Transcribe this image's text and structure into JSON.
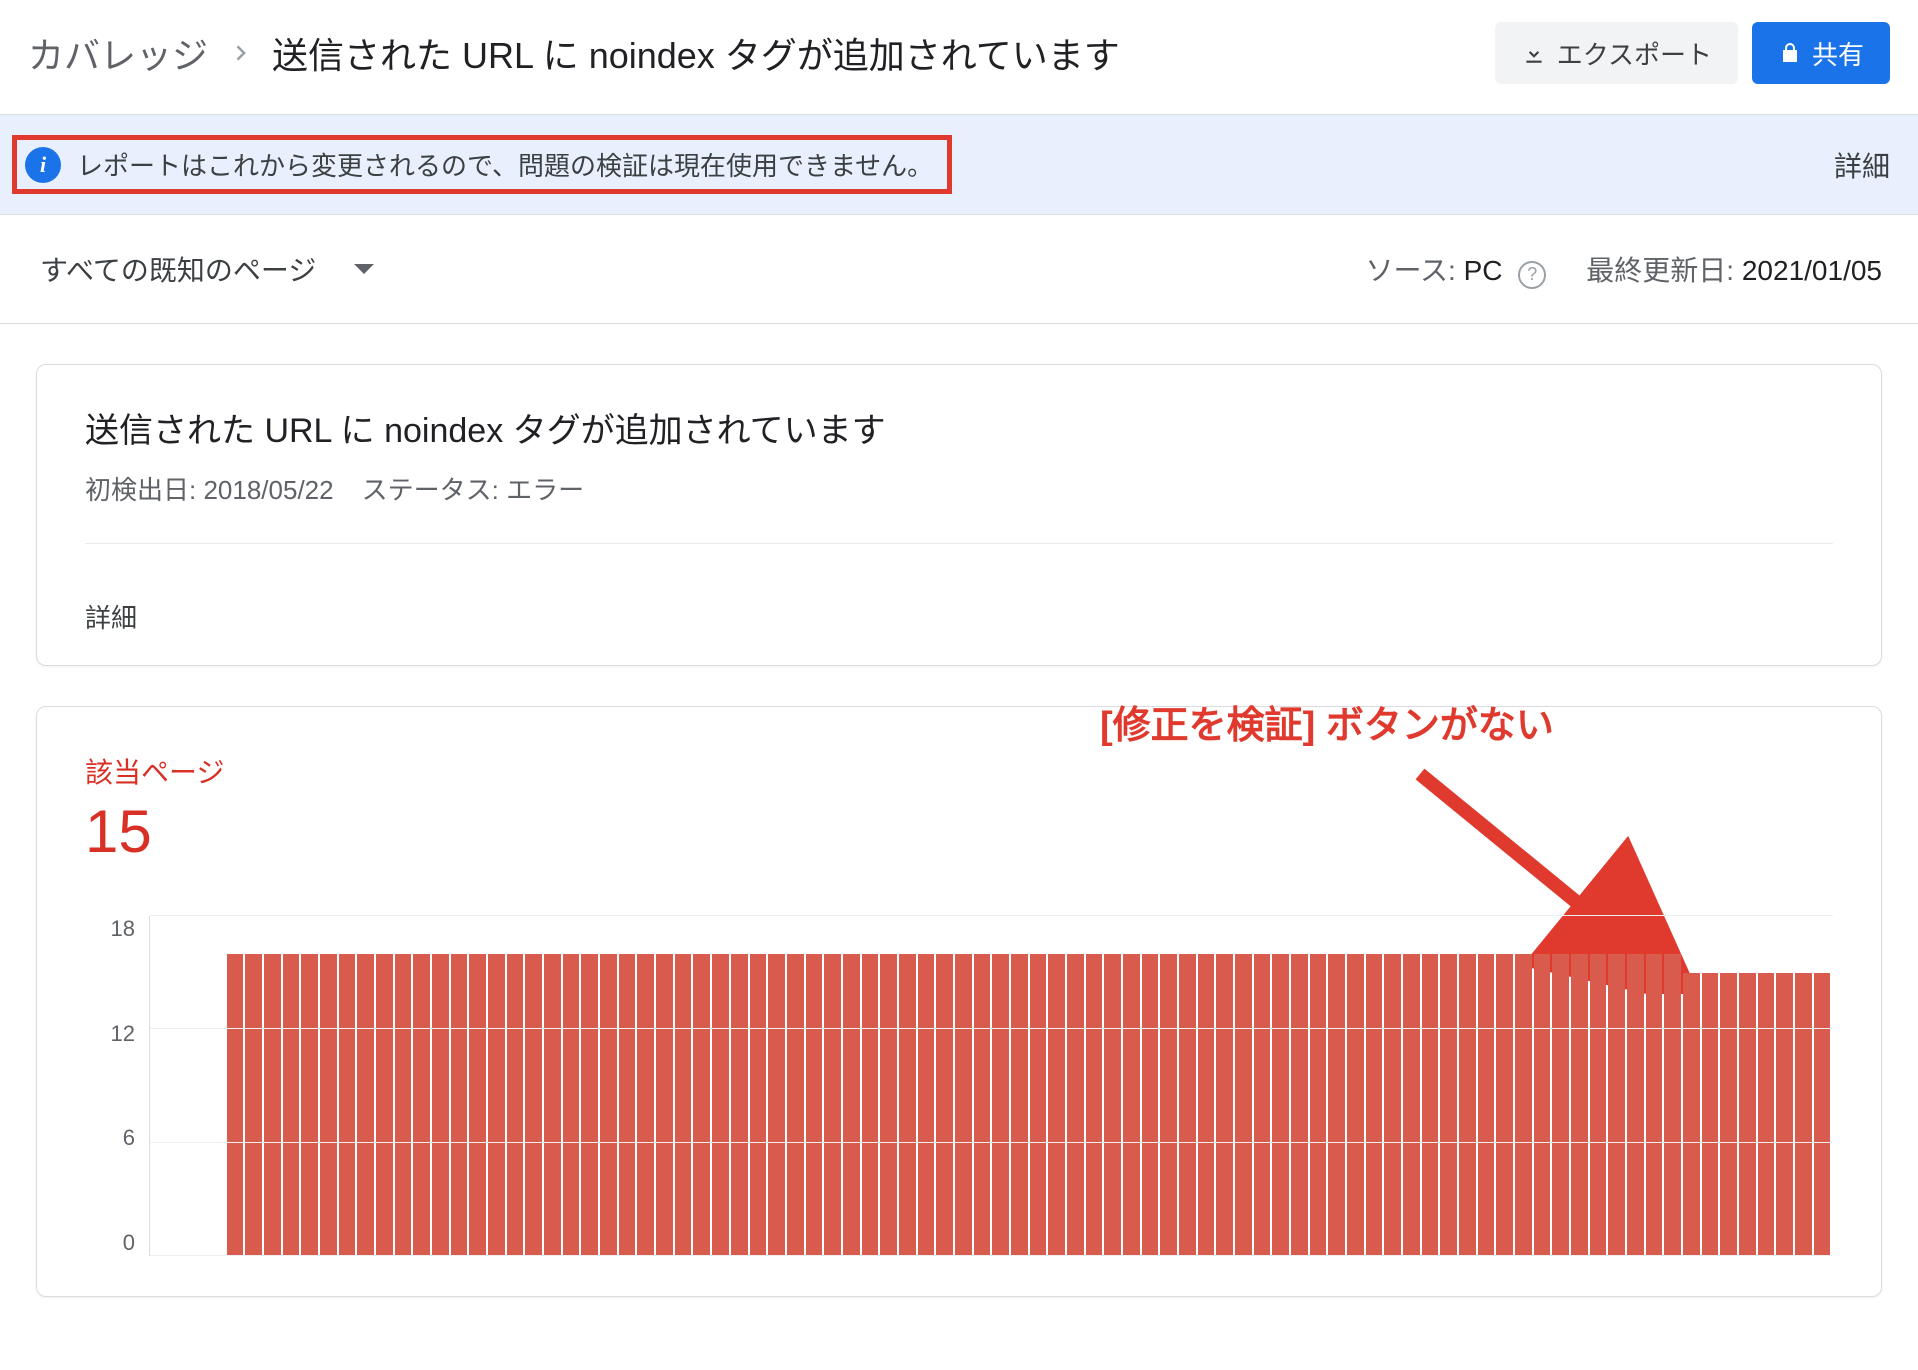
{
  "header": {
    "breadcrumb_root": "カバレッジ",
    "breadcrumb_current": "送信された URL に noindex タグが追加されています",
    "export_label": "エクスポート",
    "share_label": "共有"
  },
  "banner": {
    "text": "レポートはこれから変更されるので、問題の検証は現在使用できません。",
    "details_label": "詳細"
  },
  "filter": {
    "dropdown_label": "すべての既知のページ",
    "source_label": "ソース:",
    "source_value": "PC",
    "updated_label": "最終更新日:",
    "updated_value": "2021/01/05"
  },
  "card": {
    "title": "送信された URL に noindex タグが追加されています",
    "first_detected_label": "初検出日:",
    "first_detected_value": "2018/05/22",
    "status_label": "ステータス:",
    "status_value": "エラー",
    "details_label": "詳細"
  },
  "annotation": {
    "text": "[修正を検証] ボタンがない"
  },
  "chart": {
    "label": "該当ページ",
    "value": "15"
  },
  "chart_data": {
    "type": "bar",
    "title": "該当ページ",
    "ylabel": "",
    "xlabel": "",
    "ylim": [
      0,
      18
    ],
    "y_ticks": [
      18,
      12,
      6,
      0
    ],
    "categories_count": 90,
    "series": [
      {
        "name": "該当ページ",
        "color": "#d95b4e",
        "values": [
          0,
          0,
          0,
          0,
          16,
          16,
          16,
          16,
          16,
          16,
          16,
          16,
          16,
          16,
          16,
          16,
          16,
          16,
          16,
          16,
          16,
          16,
          16,
          16,
          16,
          16,
          16,
          16,
          16,
          16,
          16,
          16,
          16,
          16,
          16,
          16,
          16,
          16,
          16,
          16,
          16,
          16,
          16,
          16,
          16,
          16,
          16,
          16,
          16,
          16,
          16,
          16,
          16,
          16,
          16,
          16,
          16,
          16,
          16,
          16,
          16,
          16,
          16,
          16,
          16,
          16,
          16,
          16,
          16,
          16,
          16,
          16,
          16,
          16,
          16,
          16,
          16,
          16,
          16,
          16,
          16,
          16,
          15,
          15,
          15,
          15,
          15,
          15,
          15,
          15
        ]
      }
    ]
  }
}
